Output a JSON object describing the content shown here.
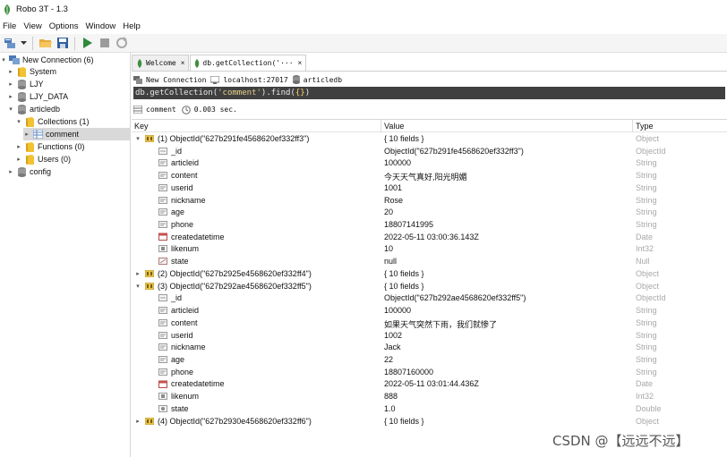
{
  "window": {
    "title": "Robo 3T - 1.3"
  },
  "menu": [
    "File",
    "View",
    "Options",
    "Window",
    "Help"
  ],
  "toolbar": [
    "connect-icon",
    "dropdown-icon",
    "open-folder-icon",
    "save-icon",
    "run-icon",
    "stop-icon",
    "refresh-icon"
  ],
  "sidebar": {
    "items": [
      {
        "label": "New Connection (6)",
        "level": 0,
        "expanded": true,
        "icon": "server-icon"
      },
      {
        "label": "System",
        "level": 1,
        "expanded": false,
        "icon": "folder-icon"
      },
      {
        "label": "LJY",
        "level": 1,
        "expanded": false,
        "icon": "database-icon"
      },
      {
        "label": "LJY_DATA",
        "level": 1,
        "expanded": false,
        "icon": "database-icon"
      },
      {
        "label": "articledb",
        "level": 1,
        "expanded": true,
        "icon": "database-icon"
      },
      {
        "label": "Collections (1)",
        "level": 2,
        "expanded": true,
        "icon": "folder-icon"
      },
      {
        "label": "comment",
        "level": 3,
        "expanded": false,
        "icon": "collection-icon",
        "selected": true
      },
      {
        "label": "Functions (0)",
        "level": 2,
        "expanded": false,
        "icon": "folder-icon"
      },
      {
        "label": "Users (0)",
        "level": 2,
        "expanded": false,
        "icon": "folder-icon"
      },
      {
        "label": "config",
        "level": 1,
        "expanded": false,
        "icon": "database-icon"
      }
    ]
  },
  "tabs": [
    {
      "label": "Welcome",
      "close": "×",
      "active": false
    },
    {
      "label": "db.getCollection('···",
      "close": "×",
      "active": true
    }
  ],
  "connection": {
    "name": "New Connection",
    "host": "localhost:27017",
    "database": "articledb"
  },
  "query": {
    "prefix": "db.getCollection(",
    "collection": "'comment'",
    "suffix": ").find(",
    "args": "{}",
    "end": ")"
  },
  "result": {
    "collection": "comment",
    "time": "0.003 sec."
  },
  "columns": {
    "key": "Key",
    "value": "Value",
    "type": "Type"
  },
  "rows": [
    {
      "level": 0,
      "arrow": "▾",
      "icon": "object-icon",
      "key": "(1) ObjectId(\"627b291fe4568620ef332ff3\")",
      "value": "{ 10 fields }",
      "type": "Object"
    },
    {
      "level": 1,
      "icon": "objectid-icon",
      "key": "_id",
      "value": "ObjectId(\"627b291fe4568620ef332ff3\")",
      "type": "ObjectId"
    },
    {
      "level": 1,
      "icon": "string-icon",
      "key": "articleid",
      "value": "100000",
      "type": "String"
    },
    {
      "level": 1,
      "icon": "string-icon",
      "key": "content",
      "value": "今天天气真好,阳光明媚",
      "type": "String"
    },
    {
      "level": 1,
      "icon": "string-icon",
      "key": "userid",
      "value": "1001",
      "type": "String"
    },
    {
      "level": 1,
      "icon": "string-icon",
      "key": "nickname",
      "value": "Rose",
      "type": "String"
    },
    {
      "level": 1,
      "icon": "string-icon",
      "key": "age",
      "value": "20",
      "type": "String"
    },
    {
      "level": 1,
      "icon": "string-icon",
      "key": "phone",
      "value": "18807141995",
      "type": "String"
    },
    {
      "level": 1,
      "icon": "date-icon",
      "key": "createdatetime",
      "value": "2022-05-11 03:00:36.143Z",
      "type": "Date"
    },
    {
      "level": 1,
      "icon": "int-icon",
      "key": "likenum",
      "value": "10",
      "type": "Int32"
    },
    {
      "level": 1,
      "icon": "null-icon",
      "key": "state",
      "value": "null",
      "type": "Null"
    },
    {
      "level": 0,
      "arrow": "▸",
      "icon": "object-icon",
      "key": "(2) ObjectId(\"627b2925e4568620ef332ff4\")",
      "value": "{ 10 fields }",
      "type": "Object"
    },
    {
      "level": 0,
      "arrow": "▾",
      "icon": "object-icon",
      "key": "(3) ObjectId(\"627b292ae4568620ef332ff5\")",
      "value": "{ 10 fields }",
      "type": "Object"
    },
    {
      "level": 1,
      "icon": "objectid-icon",
      "key": "_id",
      "value": "ObjectId(\"627b292ae4568620ef332ff5\")",
      "type": "ObjectId"
    },
    {
      "level": 1,
      "icon": "string-icon",
      "key": "articleid",
      "value": "100000",
      "type": "String"
    },
    {
      "level": 1,
      "icon": "string-icon",
      "key": "content",
      "value": "如果天气突然下雨，我们就惨了",
      "type": "String"
    },
    {
      "level": 1,
      "icon": "string-icon",
      "key": "userid",
      "value": "1002",
      "type": "String"
    },
    {
      "level": 1,
      "icon": "string-icon",
      "key": "nickname",
      "value": "Jack",
      "type": "String"
    },
    {
      "level": 1,
      "icon": "string-icon",
      "key": "age",
      "value": "22",
      "type": "String"
    },
    {
      "level": 1,
      "icon": "string-icon",
      "key": "phone",
      "value": "18807160000",
      "type": "String"
    },
    {
      "level": 1,
      "icon": "date-icon",
      "key": "createdatetime",
      "value": "2022-05-11 03:01:44.436Z",
      "type": "Date"
    },
    {
      "level": 1,
      "icon": "int-icon",
      "key": "likenum",
      "value": "888",
      "type": "Int32"
    },
    {
      "level": 1,
      "icon": "double-icon",
      "key": "state",
      "value": "1.0",
      "type": "Double"
    },
    {
      "level": 0,
      "arrow": "▸",
      "icon": "object-icon",
      "key": "(4) ObjectId(\"627b2930e4568620ef332ff6\")",
      "value": "{ 10 fields }",
      "type": "Object"
    }
  ],
  "watermark": "CSDN @【远远不远】",
  "colors": {
    "accent_green": "#3a8e3a",
    "query_bg": "#404040",
    "type_text": "#a8a8a8",
    "selection": "#d9d9d9"
  }
}
